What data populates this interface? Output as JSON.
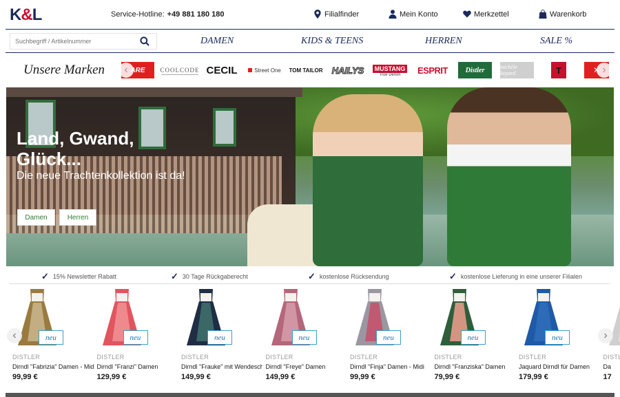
{
  "header": {
    "logo": {
      "k": "K",
      "amp": "&",
      "l": "L"
    },
    "hotline_label": "Service-Hotline:",
    "hotline_number": "+49 881 180 180",
    "links": [
      {
        "label": "Filialfinder",
        "icon": "location-pin-icon"
      },
      {
        "label": "Mein Konto",
        "icon": "user-icon"
      },
      {
        "label": "Merkzettel",
        "icon": "heart-icon"
      },
      {
        "label": "Warenkorb",
        "icon": "shopping-bag-icon"
      }
    ]
  },
  "search": {
    "placeholder": "Suchbegriff / Artikelnummer"
  },
  "nav": {
    "items": [
      "DAMEN",
      "KIDS & TEENS",
      "HERREN",
      "SALE %"
    ]
  },
  "brands": {
    "title": "Unsere Marken",
    "items": [
      "ARE",
      "COOLCODE",
      "CECIL",
      "Street One",
      "TOM TAILOR",
      "HAILYS",
      "MUSTANG",
      "ESPRIT",
      "Distler",
      "michèle boyard",
      "T"
    ],
    "mustang_sub": "True Denim"
  },
  "hero": {
    "title": "Land, Gwand, Glück...",
    "subtitle": "Die neue Trachtenkollektion ist da!",
    "buttons": [
      "Damen",
      "Herren"
    ]
  },
  "usps": [
    "15% Newsletter Rabatt",
    "30 Tage Rückgaberecht",
    "kostenlose Rücksendung",
    "kostenlose Lieferung in eine unserer Filialen"
  ],
  "products": [
    {
      "brand": "DISTLER",
      "name": "Dirndl \"Fabrizia\" Damen - Midi",
      "price": "99,99 €",
      "badge": "neu",
      "dress_color": "#9a7a3f",
      "apron_color": "#c6b48a"
    },
    {
      "brand": "DISTLER",
      "name": "Dirndl \"Franzi\" Damen",
      "price": "129,99 €",
      "badge": "neu",
      "dress_color": "#e0555e",
      "apron_color": "#f08f93"
    },
    {
      "brand": "DISTLER",
      "name": "Dirndl \"Frauke\" mit Wendesch...",
      "price": "149,99 €",
      "badge": "neu",
      "dress_color": "#1f2d45",
      "apron_color": "#3f6e6a"
    },
    {
      "brand": "DISTLER",
      "name": "Dirndl \"Freye\" Damen",
      "price": "149,99 €",
      "badge": "neu",
      "dress_color": "#b4667a",
      "apron_color": "#d59aa7"
    },
    {
      "brand": "DISTLER",
      "name": "Dirndl \"Finja\" Damen - Midi",
      "price": "99,99 €",
      "badge": "neu",
      "dress_color": "#9a97a1",
      "apron_color": "#c4526b"
    },
    {
      "brand": "DISTLER",
      "name": "Dirndl \"Franziska\" Damen",
      "price": "79,99 €",
      "badge": "neu",
      "dress_color": "#2e5e3a",
      "apron_color": "#e59b8a"
    },
    {
      "brand": "DISTLER",
      "name": "Jaquard Dirndl für Damen",
      "price": "179,99 €",
      "badge": "neu",
      "dress_color": "#1e5aa8",
      "apron_color": "#2f6cb8"
    },
    {
      "brand": "DISTLER",
      "name": "Da",
      "price": "17",
      "badge": "",
      "dress_color": "#cfcfcf",
      "apron_color": "#e6e6e6"
    }
  ]
}
